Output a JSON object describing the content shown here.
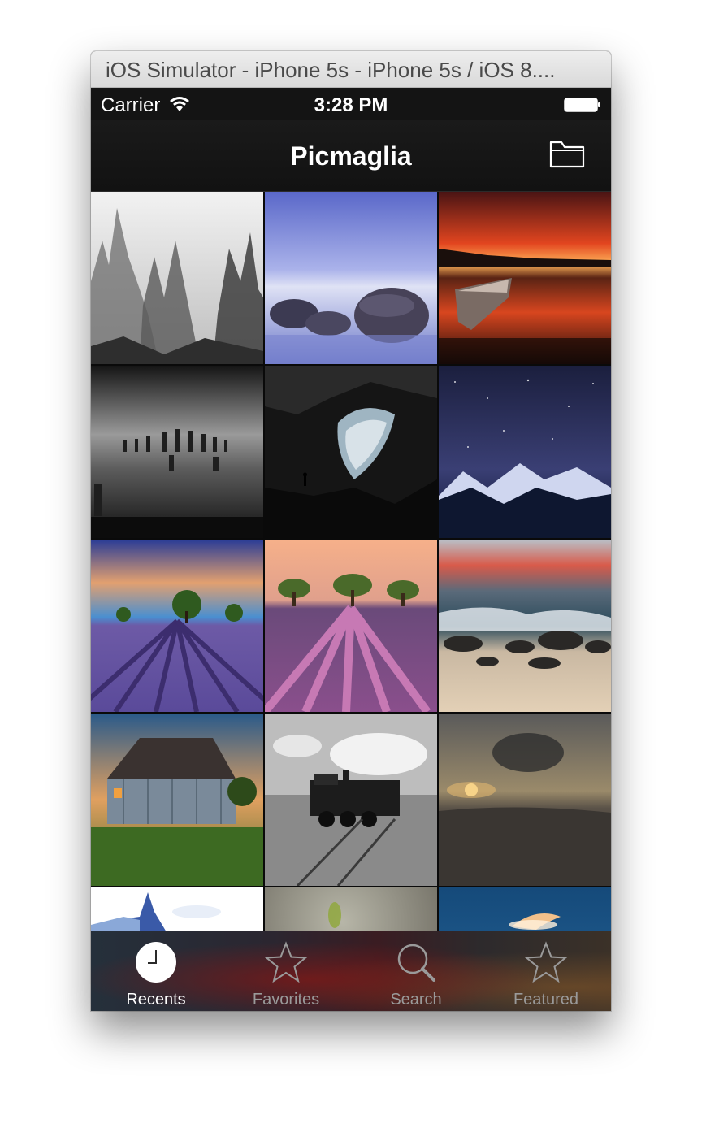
{
  "window": {
    "title": "iOS Simulator - iPhone 5s - iPhone 5s / iOS 8...."
  },
  "status_bar": {
    "carrier": "Carrier",
    "time": "3:28 PM",
    "icons": [
      "wifi-icon",
      "battery-icon"
    ]
  },
  "nav_bar": {
    "title": "Picmaglia",
    "right_button_icon": "folder-icon"
  },
  "photos": [
    "misty-karst-mountains",
    "boulders-at-twilight-sea",
    "sunset-lake-canoe",
    "old-pier-pilings-bw",
    "cave-with-explorer",
    "starry-sky-over-mountains",
    "lavender-field-sunset-tree",
    "lavender-rows-three-trees",
    "rocky-beach-sunset",
    "weathered-barn",
    "steam-locomotive-bw",
    "sunset-beach-clouds",
    "glass-building",
    "blurred-plant",
    "blue-sky-clouds"
  ],
  "tab_bar": {
    "tabs": [
      {
        "label": "Recents",
        "icon": "clock-icon",
        "active": true
      },
      {
        "label": "Favorites",
        "icon": "star-icon",
        "active": false
      },
      {
        "label": "Search",
        "icon": "magnifier-icon",
        "active": false
      },
      {
        "label": "Featured",
        "icon": "star-icon",
        "active": false
      }
    ]
  },
  "colors": {
    "tab_active": "#ffffff",
    "tab_inactive": "#9a9a9a",
    "nav_background": "#141414"
  }
}
